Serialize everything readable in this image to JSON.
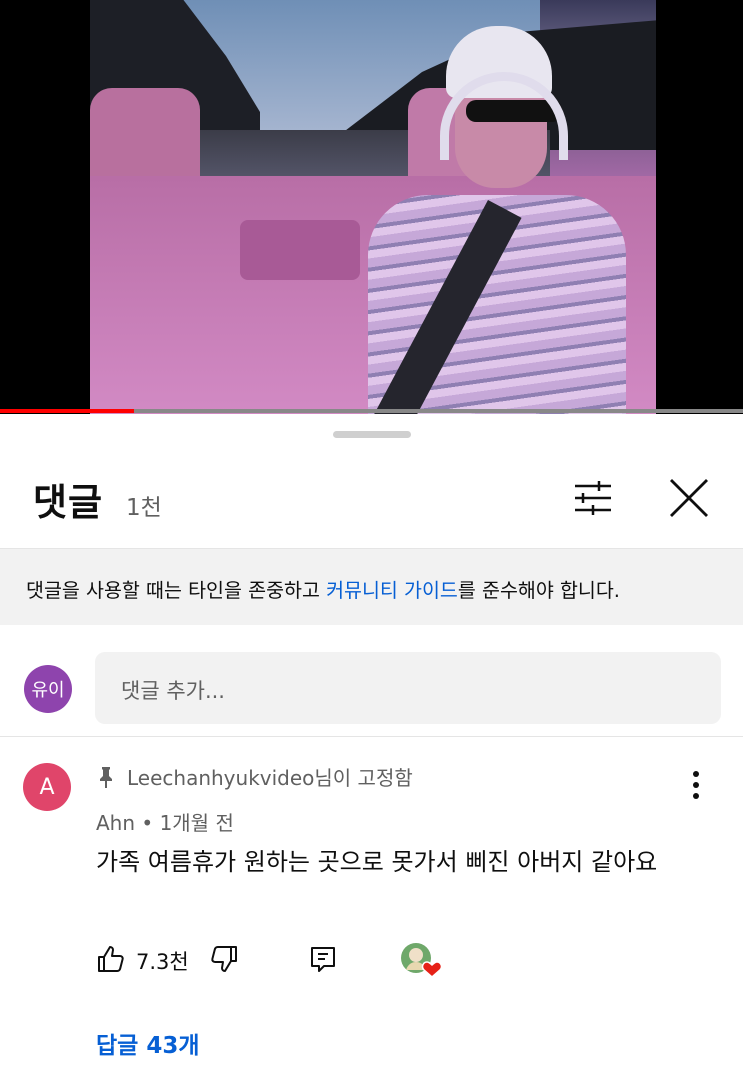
{
  "video": {
    "progress": 0.18
  },
  "comments_panel": {
    "title": "댓글",
    "count": "1천",
    "notice_prefix": "댓글을 사용할 때는 타인을 존중하고 ",
    "notice_link": "커뮤니티 가이드",
    "notice_suffix": "를 준수해야 합니다.",
    "user_avatar": "유이",
    "add_placeholder": "댓글 추가..."
  },
  "pinned_comment": {
    "avatar_letter": "A",
    "pinned_by": "Leechanhyukvideo님이 고정함",
    "author": "Ahn",
    "time": "1개월 전",
    "separator": "•",
    "text": "가족 여름휴가 원하는 곳으로 못가서 삐진 아버지 같아요",
    "likes": "7.3천",
    "replies": "답글 43개"
  },
  "colors": {
    "link": "#065fd4",
    "progress": "#ff0000",
    "avatar_me": "#8e44ad",
    "avatar_a": "#e0456a"
  },
  "icons": [
    "filter-icon",
    "close-icon",
    "pin-icon",
    "more-vert-icon",
    "thumbs-up-icon",
    "thumbs-down-icon",
    "reply-icon",
    "creator-heart-icon"
  ]
}
